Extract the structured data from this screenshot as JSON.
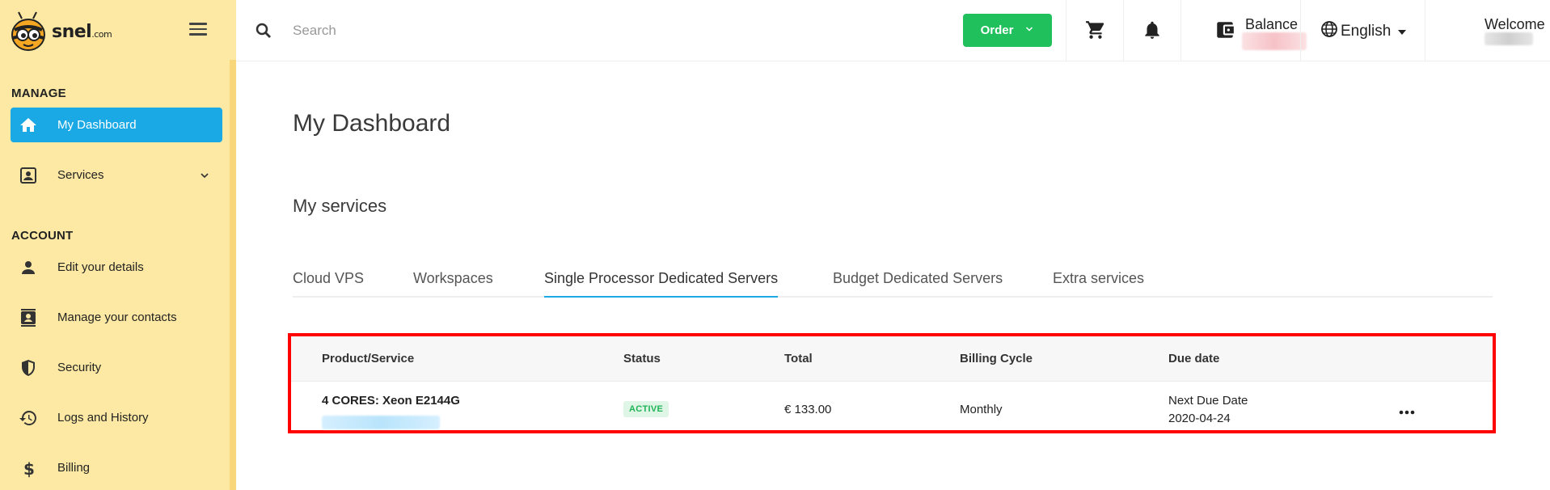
{
  "brand": {
    "logo_text": "snel",
    "logo_suffix": ".com"
  },
  "sidebar": {
    "sections": [
      {
        "title": "MANAGE"
      },
      {
        "title": "ACCOUNT"
      }
    ],
    "items": [
      {
        "label": "My Dashboard",
        "icon": "home-icon",
        "active": true
      },
      {
        "label": "Services",
        "icon": "services-icon"
      },
      {
        "label": "Edit your details",
        "icon": "person-icon"
      },
      {
        "label": "Manage your contacts",
        "icon": "contacts-icon"
      },
      {
        "label": "Security",
        "icon": "shield-icon"
      },
      {
        "label": "Logs and History",
        "icon": "history-icon"
      },
      {
        "label": "Billing",
        "icon": "dollar-icon"
      }
    ]
  },
  "header": {
    "search_placeholder": "Search",
    "order_label": "Order",
    "balance_label": "Balance",
    "language": "English",
    "welcome_label": "Welcome"
  },
  "main": {
    "title": "My Dashboard",
    "section_title": "My services",
    "tabs": [
      {
        "label": "Cloud VPS"
      },
      {
        "label": "Workspaces"
      },
      {
        "label": "Single Processor Dedicated Servers",
        "active": true
      },
      {
        "label": "Budget Dedicated Servers"
      },
      {
        "label": "Extra services"
      }
    ],
    "table": {
      "headers": [
        "Product/Service",
        "Status",
        "Total",
        "Billing Cycle",
        "Due date"
      ],
      "rows": [
        {
          "product": "4 CORES: Xeon E2144G",
          "status": "ACTIVE",
          "total": "€ 133.00",
          "billing_cycle": "Monthly",
          "due_label": "Next Due Date",
          "due_date": "2020-04-24"
        }
      ]
    }
  },
  "colors": {
    "sidebar_bg": "#fde9a3",
    "accent_blue": "#1ba9e6",
    "order_green": "#20c05c",
    "highlight_red": "#ff0000"
  }
}
